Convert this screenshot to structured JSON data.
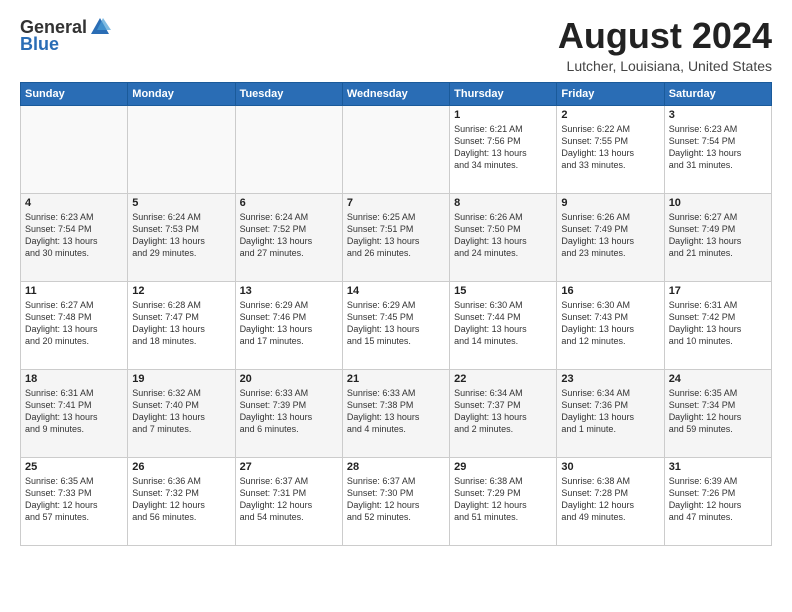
{
  "logo": {
    "general": "General",
    "blue": "Blue"
  },
  "title": {
    "month": "August 2024",
    "location": "Lutcher, Louisiana, United States"
  },
  "weekdays": [
    "Sunday",
    "Monday",
    "Tuesday",
    "Wednesday",
    "Thursday",
    "Friday",
    "Saturday"
  ],
  "weeks": [
    [
      {
        "day": "",
        "content": ""
      },
      {
        "day": "",
        "content": ""
      },
      {
        "day": "",
        "content": ""
      },
      {
        "day": "",
        "content": ""
      },
      {
        "day": "1",
        "content": "Sunrise: 6:21 AM\nSunset: 7:56 PM\nDaylight: 13 hours\nand 34 minutes."
      },
      {
        "day": "2",
        "content": "Sunrise: 6:22 AM\nSunset: 7:55 PM\nDaylight: 13 hours\nand 33 minutes."
      },
      {
        "day": "3",
        "content": "Sunrise: 6:23 AM\nSunset: 7:54 PM\nDaylight: 13 hours\nand 31 minutes."
      }
    ],
    [
      {
        "day": "4",
        "content": "Sunrise: 6:23 AM\nSunset: 7:54 PM\nDaylight: 13 hours\nand 30 minutes."
      },
      {
        "day": "5",
        "content": "Sunrise: 6:24 AM\nSunset: 7:53 PM\nDaylight: 13 hours\nand 29 minutes."
      },
      {
        "day": "6",
        "content": "Sunrise: 6:24 AM\nSunset: 7:52 PM\nDaylight: 13 hours\nand 27 minutes."
      },
      {
        "day": "7",
        "content": "Sunrise: 6:25 AM\nSunset: 7:51 PM\nDaylight: 13 hours\nand 26 minutes."
      },
      {
        "day": "8",
        "content": "Sunrise: 6:26 AM\nSunset: 7:50 PM\nDaylight: 13 hours\nand 24 minutes."
      },
      {
        "day": "9",
        "content": "Sunrise: 6:26 AM\nSunset: 7:49 PM\nDaylight: 13 hours\nand 23 minutes."
      },
      {
        "day": "10",
        "content": "Sunrise: 6:27 AM\nSunset: 7:49 PM\nDaylight: 13 hours\nand 21 minutes."
      }
    ],
    [
      {
        "day": "11",
        "content": "Sunrise: 6:27 AM\nSunset: 7:48 PM\nDaylight: 13 hours\nand 20 minutes."
      },
      {
        "day": "12",
        "content": "Sunrise: 6:28 AM\nSunset: 7:47 PM\nDaylight: 13 hours\nand 18 minutes."
      },
      {
        "day": "13",
        "content": "Sunrise: 6:29 AM\nSunset: 7:46 PM\nDaylight: 13 hours\nand 17 minutes."
      },
      {
        "day": "14",
        "content": "Sunrise: 6:29 AM\nSunset: 7:45 PM\nDaylight: 13 hours\nand 15 minutes."
      },
      {
        "day": "15",
        "content": "Sunrise: 6:30 AM\nSunset: 7:44 PM\nDaylight: 13 hours\nand 14 minutes."
      },
      {
        "day": "16",
        "content": "Sunrise: 6:30 AM\nSunset: 7:43 PM\nDaylight: 13 hours\nand 12 minutes."
      },
      {
        "day": "17",
        "content": "Sunrise: 6:31 AM\nSunset: 7:42 PM\nDaylight: 13 hours\nand 10 minutes."
      }
    ],
    [
      {
        "day": "18",
        "content": "Sunrise: 6:31 AM\nSunset: 7:41 PM\nDaylight: 13 hours\nand 9 minutes."
      },
      {
        "day": "19",
        "content": "Sunrise: 6:32 AM\nSunset: 7:40 PM\nDaylight: 13 hours\nand 7 minutes."
      },
      {
        "day": "20",
        "content": "Sunrise: 6:33 AM\nSunset: 7:39 PM\nDaylight: 13 hours\nand 6 minutes."
      },
      {
        "day": "21",
        "content": "Sunrise: 6:33 AM\nSunset: 7:38 PM\nDaylight: 13 hours\nand 4 minutes."
      },
      {
        "day": "22",
        "content": "Sunrise: 6:34 AM\nSunset: 7:37 PM\nDaylight: 13 hours\nand 2 minutes."
      },
      {
        "day": "23",
        "content": "Sunrise: 6:34 AM\nSunset: 7:36 PM\nDaylight: 13 hours\nand 1 minute."
      },
      {
        "day": "24",
        "content": "Sunrise: 6:35 AM\nSunset: 7:34 PM\nDaylight: 12 hours\nand 59 minutes."
      }
    ],
    [
      {
        "day": "25",
        "content": "Sunrise: 6:35 AM\nSunset: 7:33 PM\nDaylight: 12 hours\nand 57 minutes."
      },
      {
        "day": "26",
        "content": "Sunrise: 6:36 AM\nSunset: 7:32 PM\nDaylight: 12 hours\nand 56 minutes."
      },
      {
        "day": "27",
        "content": "Sunrise: 6:37 AM\nSunset: 7:31 PM\nDaylight: 12 hours\nand 54 minutes."
      },
      {
        "day": "28",
        "content": "Sunrise: 6:37 AM\nSunset: 7:30 PM\nDaylight: 12 hours\nand 52 minutes."
      },
      {
        "day": "29",
        "content": "Sunrise: 6:38 AM\nSunset: 7:29 PM\nDaylight: 12 hours\nand 51 minutes."
      },
      {
        "day": "30",
        "content": "Sunrise: 6:38 AM\nSunset: 7:28 PM\nDaylight: 12 hours\nand 49 minutes."
      },
      {
        "day": "31",
        "content": "Sunrise: 6:39 AM\nSunset: 7:26 PM\nDaylight: 12 hours\nand 47 minutes."
      }
    ]
  ]
}
